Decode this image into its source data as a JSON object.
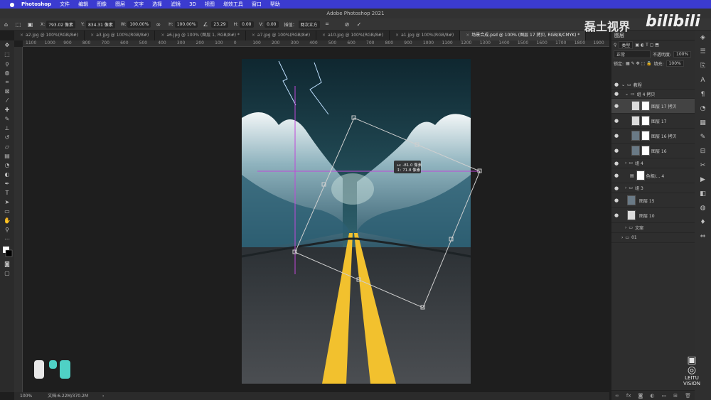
{
  "menu_bar": {
    "app_name": "Photoshop",
    "items": [
      "文件",
      "编辑",
      "图像",
      "图层",
      "文字",
      "选择",
      "滤镜",
      "3D",
      "视图",
      "增效工具",
      "窗口",
      "帮助"
    ]
  },
  "window_title": "Adobe Photoshop 2021",
  "options_bar": {
    "x": "793.02 像素",
    "y": "834.31 像素",
    "w": "100.00%",
    "h": "100.00%",
    "angle": "23.29",
    "h_skew": "0.00",
    "v_skew": "0.00",
    "interp_label": "插值：",
    "interpolation": "两次立方"
  },
  "tabs": [
    "a2.jpg @ 100%(RGB/8#)",
    "a3.jpg @ 100%(RGB/8#)",
    "a6.jpg @ 100% (图层 1, RGB/8#) *",
    "a7.jpg @ 100%(RGB/8#)",
    "a10.jpg @ 100%(RGB/8#)",
    "a1.jpg @ 100%(RGB/8#)",
    "场景合成.psd @ 100% (图层 17 拷贝, RGB/8/CMYK) *"
  ],
  "ruler_ticks": [
    "1100",
    "1000",
    "900",
    "800",
    "700",
    "600",
    "500",
    "400",
    "300",
    "200",
    "100",
    "0",
    "100",
    "200",
    "300",
    "400",
    "500",
    "600",
    "700",
    "800",
    "900",
    "1000",
    "1100",
    "1200",
    "1300",
    "1400",
    "1500",
    "1600",
    "1700",
    "1800",
    "1900"
  ],
  "transform_readout": [
    "↔: -81.0 像素",
    "↕: 71.8 像素"
  ],
  "status": {
    "zoom": "100%",
    "doc": "文档:6.22M/370.2M"
  },
  "layers_panel": {
    "title": "图层",
    "search": "类型",
    "blend_mode": "正常",
    "opacity_label": "不透明度:",
    "opacity": "100%",
    "lock_label": "锁定:",
    "fill_label": "填充:",
    "fill": "100%",
    "layers": [
      {
        "name": "教程",
        "kind": "group"
      },
      {
        "name": "组 4 拷贝",
        "kind": "group"
      },
      {
        "name": "图层 17 拷贝",
        "kind": "layer"
      },
      {
        "name": "图层 17",
        "kind": "layer"
      },
      {
        "name": "图层 16 拷贝",
        "kind": "layer"
      },
      {
        "name": "图层 16",
        "kind": "layer"
      },
      {
        "name": "组 4",
        "kind": "group"
      },
      {
        "name": "色相/... 4",
        "kind": "adjust"
      },
      {
        "name": "组 3",
        "kind": "group"
      },
      {
        "name": "图层 15",
        "kind": "layer"
      },
      {
        "name": "图层 10",
        "kind": "layer"
      },
      {
        "name": "文案",
        "kind": "group"
      },
      {
        "name": "01",
        "kind": "group"
      }
    ]
  },
  "watermark": "磊土视界",
  "bilibili": "bilibili",
  "leitu": "LEITU VISION",
  "colors": {
    "menubar": "#3b3bd0",
    "road_line": "#f2c12e",
    "sky": "#1b3b4a",
    "wave": "#3a6f84"
  }
}
